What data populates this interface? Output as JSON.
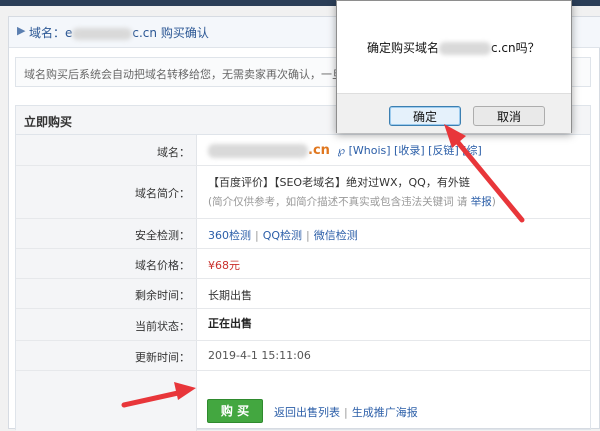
{
  "page": {
    "title_prefix": "域名：e",
    "title_suffix": "c.cn  购买确认",
    "notice": "域名购买后系统会自动把域名转移给您，无需卖家再次确认，一旦买"
  },
  "section": {
    "heading": "立即购买",
    "rows": [
      {
        "label": "域名：",
        "value": ".cn",
        "extras": [
          "Whois",
          "收录",
          "反链",
          "综"
        ]
      },
      {
        "label": "域名简介：",
        "line1": "【百度评价】【SEO老域名】绝对过WX，QQ，有外链",
        "line2_prefix": "(简介仅供参考，如简介描述不真实或包含违法关键词 请 ",
        "report": "举报",
        "line2_suffix": ")"
      },
      {
        "label": "安全检测：",
        "links": [
          "360检测",
          "QQ检测",
          "微信检测"
        ]
      },
      {
        "label": "域名价格：",
        "value": "¥68元"
      },
      {
        "label": "剩余时间：",
        "value": "长期出售"
      },
      {
        "label": "当前状态：",
        "value": "正在出售"
      },
      {
        "label": "更新时间：",
        "value": "2019-4-1 15:11:06"
      }
    ],
    "buy_button": "购 买",
    "back_link": "返回出售列表",
    "promo_link": "生成推广海报"
  },
  "dialog": {
    "message_prefix": "确定购买域名",
    "message_suffix": "c.cn吗？",
    "ok": "确定",
    "cancel": "取消"
  },
  "colors": {
    "arrow": "#e8363a",
    "buy": "#43a740",
    "domain_orange": "#e0771f",
    "link": "#2b5ea8"
  }
}
